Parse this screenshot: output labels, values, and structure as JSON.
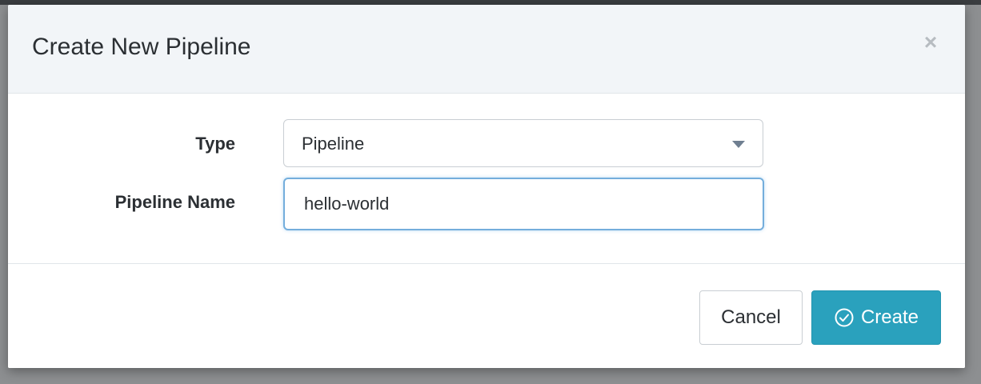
{
  "dialog": {
    "title": "Create New Pipeline",
    "close_label": "×"
  },
  "form": {
    "type_label": "Type",
    "type_value": "Pipeline",
    "name_label": "Pipeline Name",
    "name_value": "hello-world"
  },
  "footer": {
    "cancel_label": "Cancel",
    "create_label": "Create",
    "create_icon": "check-circle-icon"
  },
  "colors": {
    "primary": "#2aa1bd",
    "focus_border": "#74aedc",
    "header_bg": "#f2f5f8",
    "backdrop": "#8d8f91"
  }
}
